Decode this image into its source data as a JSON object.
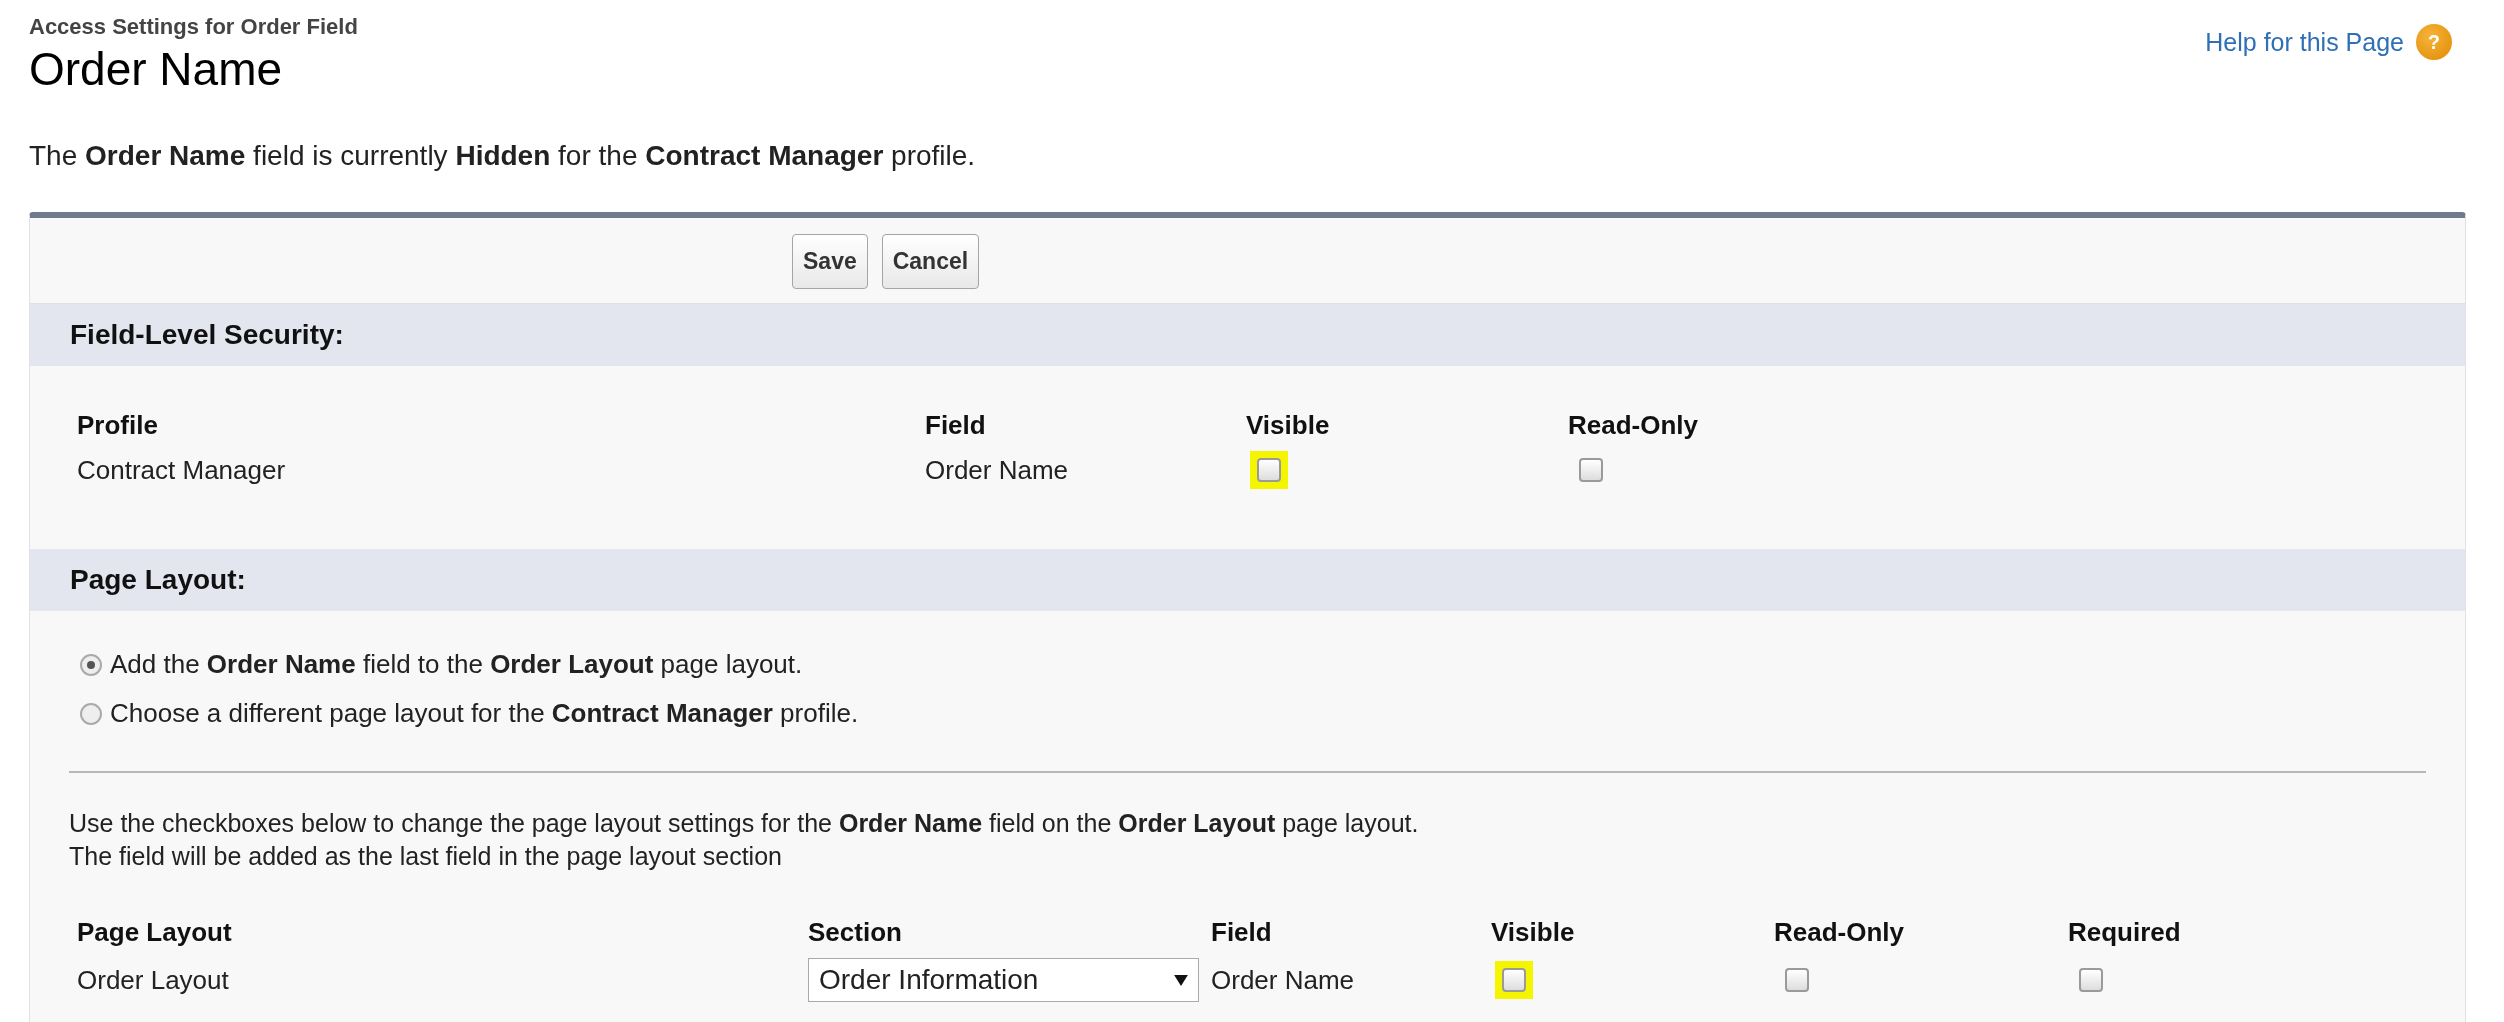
{
  "header": {
    "breadcrumb": "Access Settings for Order Field",
    "title": "Order Name",
    "help_link": "Help for this Page",
    "help_icon": "?"
  },
  "summary": "The **Order Name** field is currently **Hidden** for the **Contract Manager** profile.",
  "buttons": [
    "Save",
    "Cancel"
  ],
  "field_level_security": {
    "heading": "Field-Level Security:",
    "columns": [
      "Profile",
      "Field",
      "Visible",
      "Read-Only"
    ],
    "rows": [
      [
        {
          "kind": "text",
          "text": "Contract Manager"
        },
        {
          "kind": "text",
          "text": "Order Name"
        },
        {
          "kind": "checkbox",
          "checked": false,
          "highlighted": true
        },
        {
          "kind": "checkbox",
          "checked": false,
          "highlighted": false
        }
      ]
    ]
  },
  "page_layout": {
    "heading": "Page Layout:",
    "options": [
      {
        "label": "Add the **Order Name** field to the **Order Layout** page layout.",
        "selected": true
      },
      {
        "label": "Choose a different page layout for the **Contract Manager** profile.",
        "selected": false
      }
    ],
    "instructions": [
      "Use the checkboxes below to change the page layout settings for the **Order Name** field on the **Order Layout** page layout.",
      "The field will be added as the last field in the page layout section"
    ],
    "columns": [
      "Page Layout",
      "Section",
      "Field",
      "Visible",
      "Read-Only",
      "Required"
    ],
    "rows": [
      [
        {
          "kind": "text",
          "text": "Order Layout"
        },
        {
          "kind": "select",
          "value": "Order Information"
        },
        {
          "kind": "text",
          "text": "Order Name"
        },
        {
          "kind": "checkbox",
          "checked": false,
          "highlighted": true
        },
        {
          "kind": "checkbox",
          "checked": false,
          "highlighted": false
        },
        {
          "kind": "checkbox",
          "checked": false,
          "highlighted": false
        }
      ]
    ]
  }
}
